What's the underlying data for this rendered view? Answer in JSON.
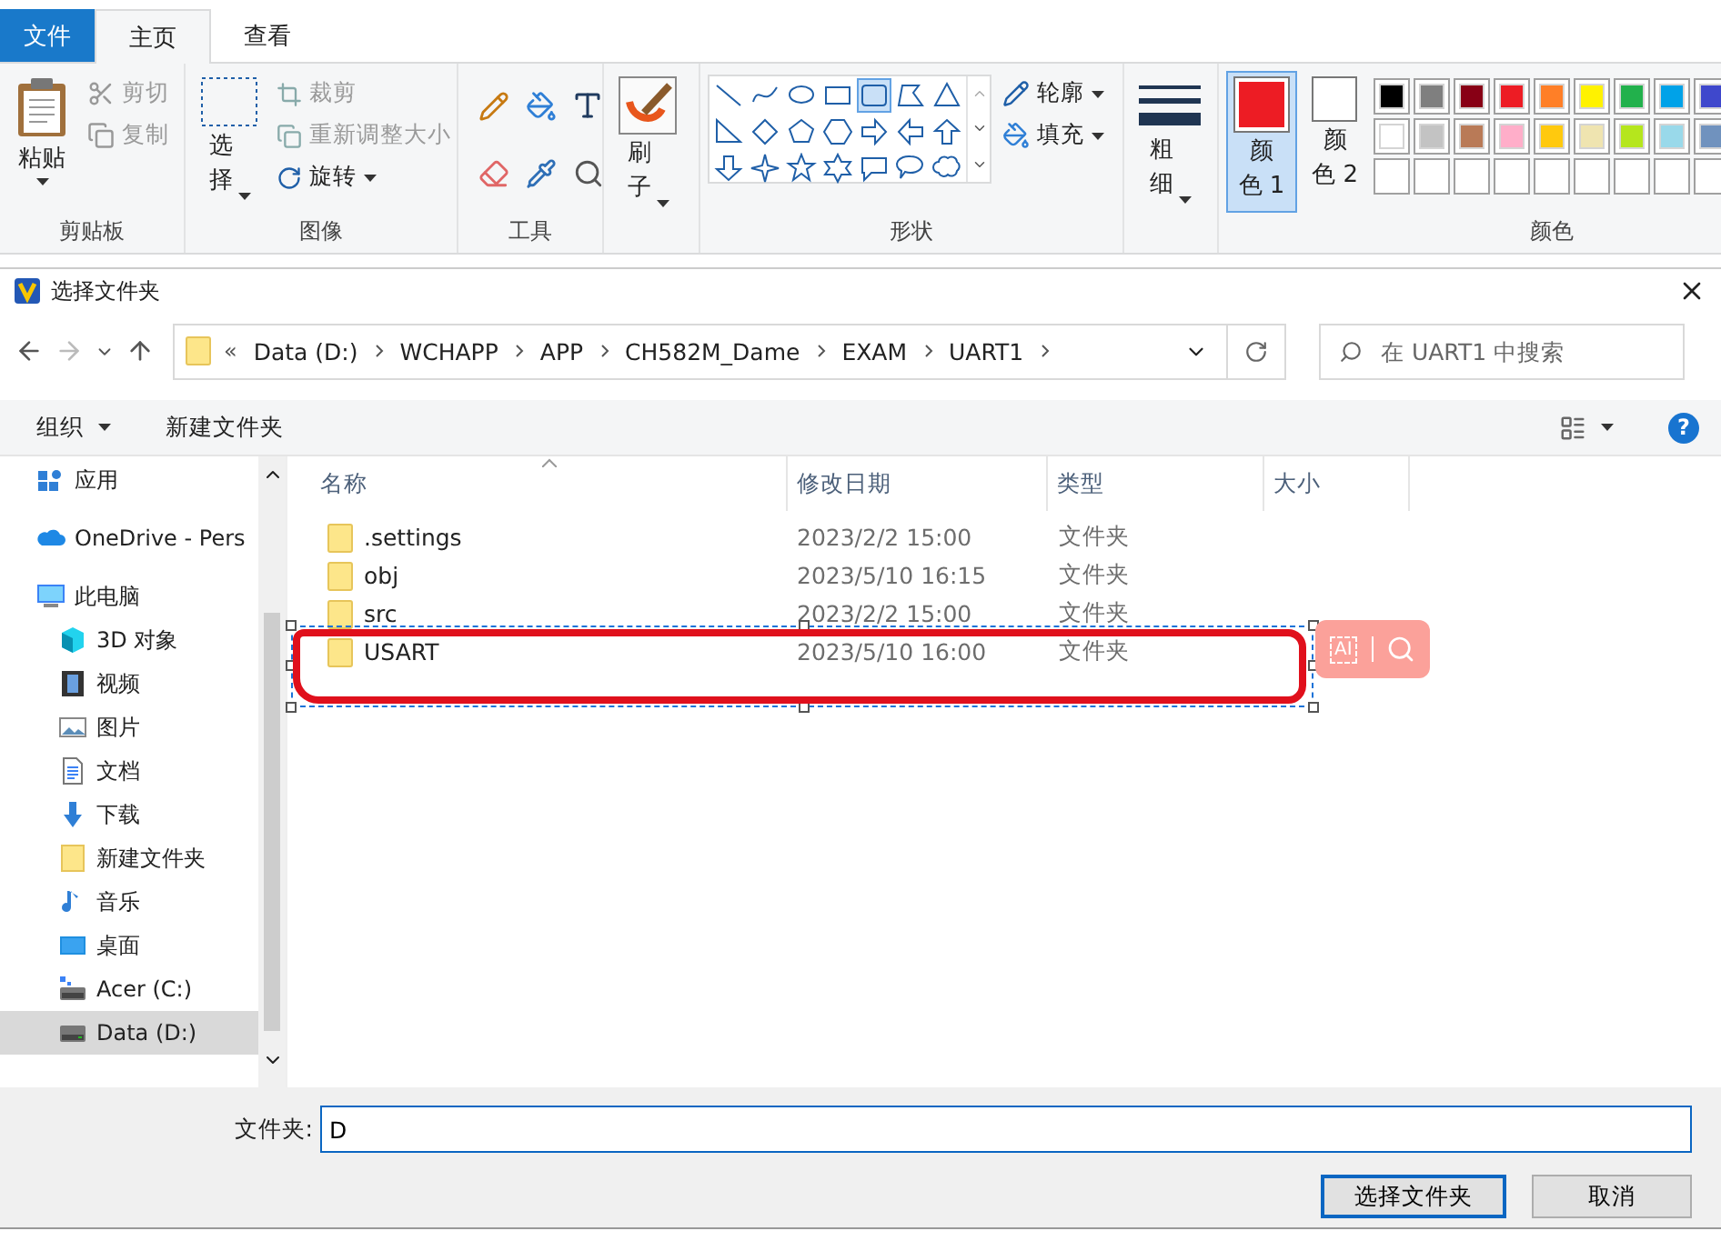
{
  "ribbon": {
    "tabs": [
      {
        "label": "文件",
        "kind": "file",
        "selected": false
      },
      {
        "label": "主页",
        "kind": "tab",
        "selected": true
      },
      {
        "label": "查看",
        "kind": "tab",
        "selected": false
      }
    ],
    "clipboard": {
      "paste": "粘贴",
      "cut": {
        "label": "剪切",
        "disabled": true
      },
      "copy": {
        "label": "复制",
        "disabled": true
      },
      "group": "剪贴板"
    },
    "image": {
      "select": "选择",
      "crop": {
        "label": "裁剪",
        "disabled": true
      },
      "resize": {
        "label": "重新调整大小",
        "disabled": true
      },
      "rotate": {
        "label": "旋转",
        "disabled": false
      },
      "group": "图像"
    },
    "tools": {
      "group": "工具"
    },
    "brush": {
      "label": "刷子"
    },
    "shapes": {
      "outline": "轮廓",
      "fill": "填充",
      "group": "形状"
    },
    "size": {
      "label": "粗细"
    },
    "color1": {
      "label": "颜色 1",
      "color": "#ed1c24",
      "selected": true
    },
    "color2": {
      "label": "颜色 2",
      "color": "#ffffff",
      "selected": false
    },
    "palette": {
      "group": "颜色",
      "rows": [
        [
          {
            "color": "#000000"
          },
          {
            "color": "#7f7f7f"
          },
          {
            "color": "#880015"
          },
          {
            "color": "#ed1c24"
          },
          {
            "color": "#ff7f27"
          },
          {
            "color": "#fff200"
          },
          {
            "color": "#22b14c"
          },
          {
            "color": "#00a2e8"
          },
          {
            "color": "#3f48cc"
          }
        ],
        [
          {
            "color": "#ffffff"
          },
          {
            "color": "#c3c3c3"
          },
          {
            "color": "#b97a57"
          },
          {
            "color": "#ffaec9"
          },
          {
            "color": "#ffc90e"
          },
          {
            "color": "#efe4b0"
          },
          {
            "color": "#b5e61d"
          },
          {
            "color": "#99d9ea"
          },
          {
            "color": "#7092be"
          }
        ]
      ]
    }
  },
  "dialog": {
    "title": "选择文件夹",
    "address": {
      "overflow": "«",
      "crumbs": [
        "Data (D:)",
        "WCHAPP",
        "APP",
        "CH582M_Dame",
        "EXAM",
        "UART1"
      ]
    },
    "search": {
      "placeholder": "在 UART1 中搜索"
    },
    "toolbar": {
      "organize": "组织",
      "new_folder": "新建文件夹",
      "help": "?"
    },
    "sidebar": {
      "items": [
        {
          "label": "应用",
          "selected": false
        },
        {
          "label": "OneDrive - Pers",
          "selected": false
        },
        {
          "label": "此电脑",
          "selected": false,
          "children": [
            {
              "label": "3D 对象",
              "selected": false
            },
            {
              "label": "视频",
              "selected": false
            },
            {
              "label": "图片",
              "selected": false
            },
            {
              "label": "文档",
              "selected": false
            },
            {
              "label": "下载",
              "selected": false
            },
            {
              "label": "新建文件夹",
              "selected": false
            },
            {
              "label": "音乐",
              "selected": false
            },
            {
              "label": "桌面",
              "selected": false
            },
            {
              "label": "Acer (C:)",
              "selected": false
            },
            {
              "label": "Data (D:)",
              "selected": true
            }
          ]
        }
      ]
    },
    "table": {
      "columns": [
        "名称",
        "修改日期",
        "类型",
        "大小"
      ],
      "rows": [
        {
          "name": ".settings",
          "modified": "2023/2/2 15:00",
          "type": "文件夹"
        },
        {
          "name": "obj",
          "modified": "2023/5/10 16:15",
          "type": "文件夹"
        },
        {
          "name": "src",
          "modified": "2023/2/2 15:00",
          "type": "文件夹"
        },
        {
          "name": "USART",
          "modified": "2023/5/10 16:00",
          "type": "文件夹"
        }
      ]
    },
    "annotation": {
      "ai_label": "AI"
    },
    "folder_field": {
      "label": "文件夹:",
      "value": "D"
    },
    "buttons": [
      {
        "label": "选择文件夹",
        "kind": "primary"
      },
      {
        "label": "取消",
        "kind": "normal"
      }
    ]
  }
}
